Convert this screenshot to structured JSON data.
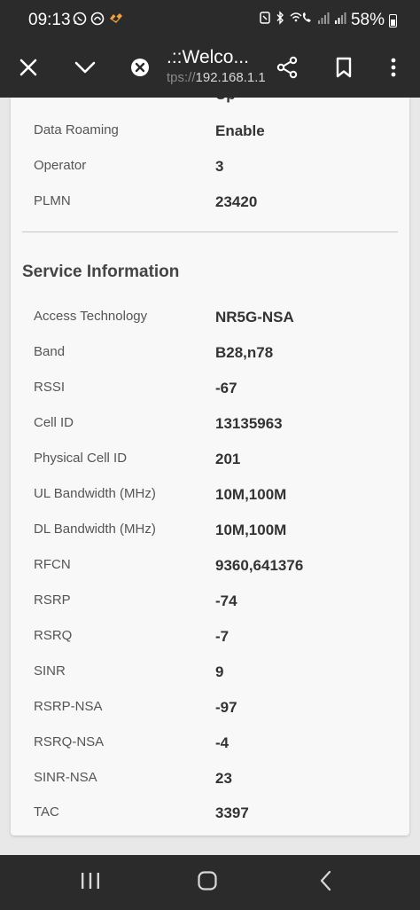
{
  "status_bar": {
    "time": "09:13",
    "battery_percent": "58%",
    "left_icons": [
      "whatsapp-icon",
      "app-icon",
      "app-icon"
    ],
    "right_icons": [
      "nfc-icon",
      "bluetooth-icon",
      "wifi-calling-icon",
      "signal-icon",
      "signal-icon"
    ]
  },
  "toolbar": {
    "title": ".::Welco...",
    "url_prefix": "tps://",
    "url_host": "192.168.1.1"
  },
  "connection_info": {
    "cut_value": "Up",
    "rows": [
      {
        "label": "Data Roaming",
        "value": "Enable"
      },
      {
        "label": "Operator",
        "value": "3"
      },
      {
        "label": "PLMN",
        "value": "23420"
      }
    ]
  },
  "service_info": {
    "title": "Service Information",
    "rows": [
      {
        "label": "Access Technology",
        "value": "NR5G-NSA"
      },
      {
        "label": "Band",
        "value": "B28,n78"
      },
      {
        "label": "RSSI",
        "value": "-67"
      },
      {
        "label": "Cell ID",
        "value": "13135963"
      },
      {
        "label": "Physical Cell ID",
        "value": "201"
      },
      {
        "label": "UL Bandwidth (MHz)",
        "value": "10M,100M"
      },
      {
        "label": "DL Bandwidth (MHz)",
        "value": "10M,100M"
      },
      {
        "label": "RFCN",
        "value": "9360,641376"
      },
      {
        "label": "RSRP",
        "value": "-74"
      },
      {
        "label": "RSRQ",
        "value": "-7"
      },
      {
        "label": "SINR",
        "value": "9"
      },
      {
        "label": "RSRP-NSA",
        "value": "-97"
      },
      {
        "label": "RSRQ-NSA",
        "value": "-4"
      },
      {
        "label": "SINR-NSA",
        "value": "23"
      },
      {
        "label": "TAC",
        "value": "3397"
      }
    ]
  },
  "colors": {
    "chrome_bg": "#2b2b2b",
    "page_bg": "#e8e8e8",
    "card_bg": "#f8f8f8",
    "label_text": "#555555",
    "value_text": "#333333",
    "accent_orange": "#f4a13a"
  }
}
